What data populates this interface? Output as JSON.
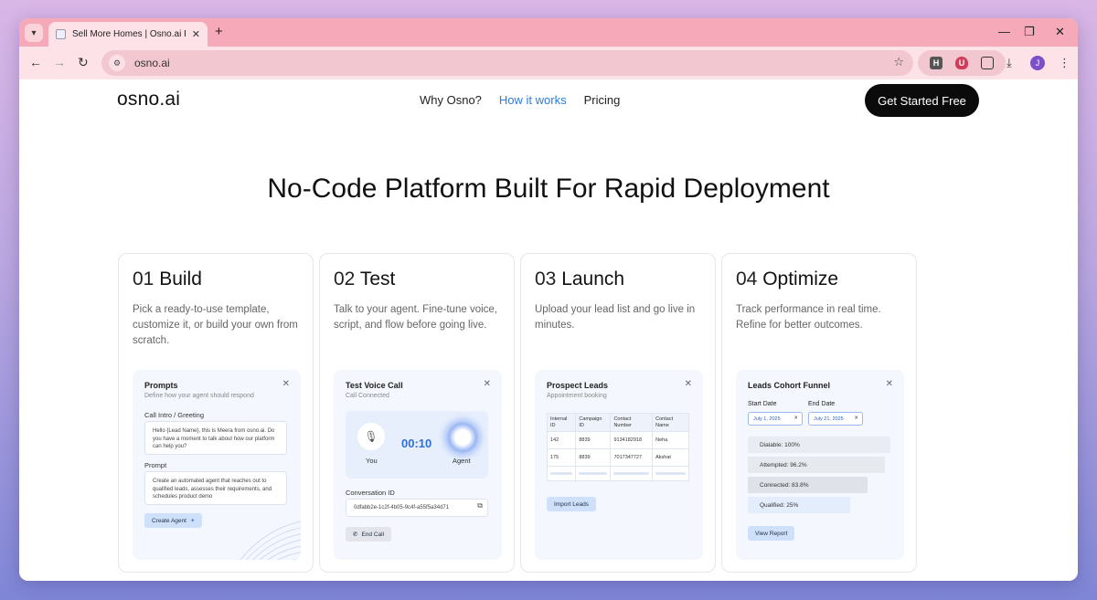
{
  "browser": {
    "tab_title": "Sell More Homes | Osno.ai Real Estate",
    "url": "osno.ai",
    "avatar_letter": "J",
    "ext_h_label": "H"
  },
  "site": {
    "logo": "osno.ai",
    "nav": [
      "Why Osno?",
      "How it works",
      "Pricing"
    ],
    "cta": "Get Started Free",
    "headline": "No-Code Platform Built For Rapid Deployment"
  },
  "cards": [
    {
      "num": "01",
      "title": "Build",
      "desc": "Pick a ready-to-use template, customize it, or build your own from scratch.",
      "mock": {
        "title": "Prompts",
        "subtitle": "Define how your agent should respond",
        "label1": "Call Intro / Greeting",
        "text1": "Hello {Lead Name}, this is Meera from osno.ai. Do you have a moment to talk about how our platform can help you?",
        "label2": "Prompt",
        "text2": "Create an automated agent that reaches out to qualified leads, assesses their requirements, and schedules product demo",
        "button": "Create Agent"
      }
    },
    {
      "num": "02",
      "title": "Test",
      "desc": "Talk to your agent. Fine-tune voice, script, and flow before going live.",
      "mock": {
        "title": "Test Voice Call",
        "subtitle": "Call Connected",
        "you": "You",
        "timer": "00:10",
        "agent": "Agent",
        "conv_label": "Conversation ID",
        "conv_id": "0dfabb2e-1c2f-4b05-9c4f-a55f5a34d71",
        "button": "End Call"
      }
    },
    {
      "num": "03",
      "title": "Launch",
      "desc": "Upload your lead list and go live in minutes.",
      "mock": {
        "title": "Prospect Leads",
        "subtitle": "Appointment booking",
        "headers": [
          "Internal ID",
          "Campaign ID",
          "Contact Number",
          "Contact Name"
        ],
        "rows": [
          [
            "142",
            "8839",
            "9134182918",
            "Neha"
          ],
          [
            "175",
            "8839",
            "7017347727",
            "Akshat"
          ]
        ],
        "button": "Import Leads"
      }
    },
    {
      "num": "04",
      "title": "Optimize",
      "desc": "Track performance in real time. Refine for better outcomes.",
      "mock": {
        "title": "Leads Cohort Funnel",
        "start_label": "Start Date",
        "end_label": "End Date",
        "start_date": "July 1, 2025",
        "end_date": "July 21, 2025",
        "funnel": [
          {
            "label": "Dialable: 100%",
            "value": 100,
            "color": "#e9edf3"
          },
          {
            "label": "Attempted: 96.2%",
            "value": 96.2,
            "color": "#e6e9ee"
          },
          {
            "label": "Connected: 83.8%",
            "value": 83.8,
            "color": "#dfe3e9"
          },
          {
            "label": "Qualified: 25%",
            "value": 25,
            "color": "#e4edfc"
          }
        ],
        "button": "View Report"
      }
    }
  ]
}
